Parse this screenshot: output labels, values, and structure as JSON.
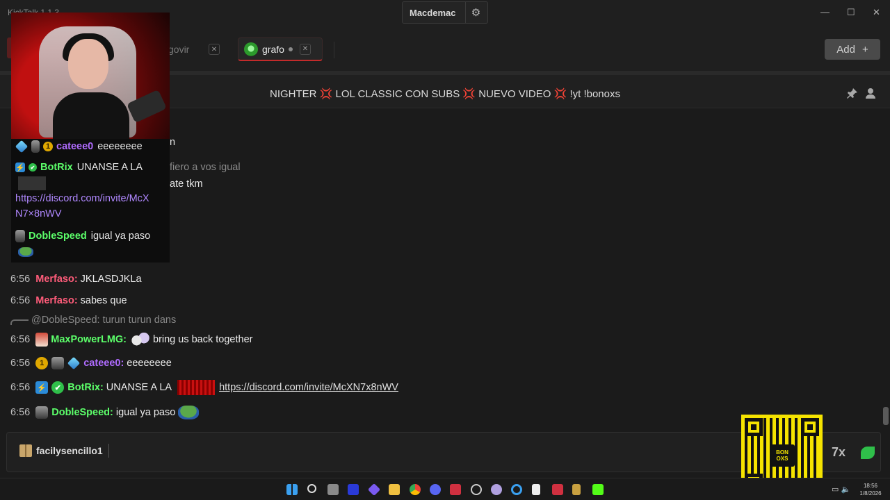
{
  "app": {
    "title": "KickTalk 1.1.3"
  },
  "header": {
    "username": "Macdemac",
    "settings_icon": "gear-icon"
  },
  "window_controls": {
    "minimize": "—",
    "maximize": "☐",
    "close": "✕"
  },
  "tabs": [
    {
      "label": "govir",
      "active": false
    },
    {
      "label": "grafo",
      "active": true
    }
  ],
  "tab_close": "✕",
  "add_button": {
    "label": "Add",
    "icon": "+"
  },
  "stream": {
    "title_parts": [
      "NIGHTER",
      "LOL CLASSIC CON SUBS",
      "NUEVO VIDEO",
      "!yt !bonoxs"
    ],
    "separator": "💢"
  },
  "ghost_text": {
    "t1": "n",
    "t2": "fiero a vos igual",
    "t3": "ate tkm"
  },
  "cam_chat": {
    "l1_user": "cateee0",
    "l1_msg": "eeeeeeee",
    "l2_user": "BotRix",
    "l2_msg": "UNANSE A LA",
    "l3_link_a": "https://discord.com/invite/McX",
    "l3_link_b": "N7×8nWV",
    "l4_user": "DobleSpeed",
    "l4_msg": "igual ya paso"
  },
  "messages": [
    {
      "time": "6:56",
      "user": "Merfaso:",
      "text": "JKLASDJKLa",
      "color": "#ff5c7a"
    },
    {
      "time": "6:56",
      "user": "Merfaso:",
      "text": "sabes que",
      "color": "#ff5c7a"
    },
    {
      "reply_to": "@DobleSpeed:",
      "reply_text": "turun turun dans"
    },
    {
      "time": "6:56",
      "user": "MaxPowerLMG:",
      "text": "bring us back together",
      "color": "#5cff6a"
    },
    {
      "time": "6:56",
      "user": "cateee0:",
      "text": "eeeeeeee",
      "color": "#b06cff"
    },
    {
      "time": "6:56",
      "user": "BotRix:",
      "text": "UNANSE A LA",
      "link": "https://discord.com/invite/McXN7x8nWV",
      "color": "#5cff6a"
    },
    {
      "time": "6:56",
      "user": "DobleSpeed:",
      "text": "igual ya paso",
      "color": "#5cff6a"
    }
  ],
  "badges": {
    "gold": "1",
    "bot": "⚡",
    "verified": "✔"
  },
  "input": {
    "username": "facilysencillo1"
  },
  "input_emote": "7x",
  "qr": {
    "logo_text": "BON OXS"
  },
  "taskbar": {
    "clock_time": "18:56",
    "clock_date": "1/8/2026"
  },
  "colors": {
    "accent": "#c42b2b",
    "kick_green": "#53fc18",
    "qr_yellow": "#f5e300"
  }
}
